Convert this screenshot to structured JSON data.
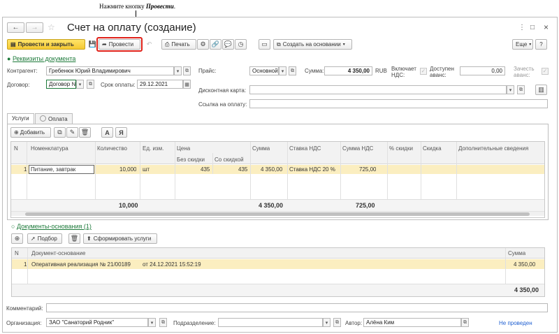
{
  "annotation": {
    "prefix": "Нажмите кнопку ",
    "emph": "Провести",
    "suffix": "."
  },
  "window": {
    "title": "Счет на оплату (создание)",
    "nav_back": "←",
    "nav_fwd": "→",
    "star": "☆",
    "more": "⋮",
    "restore": "□",
    "close": "×"
  },
  "toolbar": {
    "post_close": "Провести и закрыть",
    "post": "Провести",
    "print": "Печать",
    "create_based": "Создать на основании",
    "more": "Еще",
    "help": "?"
  },
  "details": {
    "link": "Реквизиты документа",
    "contractor_label": "Контрагент:",
    "contractor_value": "Гребенюк Юрий Владимирович",
    "contract_label": "Договор:",
    "contract_value": "Договор №",
    "due_label": "Срок оплаты:",
    "due_value": "29.12.2021",
    "price_label": "Прайс:",
    "price_value": "Основной",
    "sum_label": "Сумма:",
    "sum_value": "4 350,00",
    "currency": "RUB",
    "vat_incl_label": "Включает НДС:",
    "advance_label": "Доступен аванс:",
    "advance_value": "0,00",
    "count_advance_label": "Зачесть аванс:",
    "discount_card_label": "Дисконтная карта:",
    "discount_card_value": "",
    "pay_link_label": "Ссылка на оплату:",
    "pay_link_value": ""
  },
  "tabs": [
    "Услуги",
    "Оплата"
  ],
  "services": {
    "add": "Добавить",
    "headers": {
      "n": "N",
      "nom": "Номенклатура",
      "qty": "Количество",
      "unit": "Ед. изм.",
      "price": "Цена",
      "price_nodisc": "Без скидки",
      "price_disc": "Со скидкой",
      "sum": "Сумма",
      "vat_rate": "Ставка НДС",
      "vat_sum": "Сумма НДС",
      "disc_pct": "% скидки",
      "disc": "Скидка",
      "extra": "Дополнительные сведения"
    },
    "rows": [
      {
        "n": "1",
        "nom": "Питание, завтрак",
        "qty": "10,000",
        "unit": "шт",
        "price_nodisc": "435",
        "price_disc": "435",
        "sum": "4 350,00",
        "vat_rate": "Ставка НДС 20 %",
        "vat_sum": "725,00",
        "disc_pct": "",
        "disc": "",
        "extra": ""
      }
    ],
    "totals": {
      "qty": "10,000",
      "sum": "4 350,00",
      "vat_sum": "725,00"
    }
  },
  "basis": {
    "link": "Документы-основания (1)",
    "pick": "Подбор",
    "form_services": "Сформировать услуги",
    "headers": {
      "n": "N",
      "doc": "Документ-основание",
      "sum": "Сумма"
    },
    "rows": [
      {
        "n": "1",
        "doc": "Оперативная реализация № 21/00189",
        "date": "от 24.12.2021 15:52:19",
        "sum": "4 350,00"
      }
    ],
    "total": "4 350,00"
  },
  "footer": {
    "comment_label": "Комментарий:",
    "comment_value": "",
    "org_label": "Организация:",
    "org_value": "ЗАО \"Санаторий Родник\"",
    "dept_label": "Подразделение:",
    "dept_value": "",
    "author_label": "Автор:",
    "author_value": "Алёна Ким",
    "status": "Не проведен"
  },
  "colors": {
    "accent_yellow": "#f5c932",
    "link_green": "#1d7a3a",
    "highlight": "#e0221a",
    "status_blue": "#1f5fd1",
    "row_select": "#fbeec0"
  }
}
